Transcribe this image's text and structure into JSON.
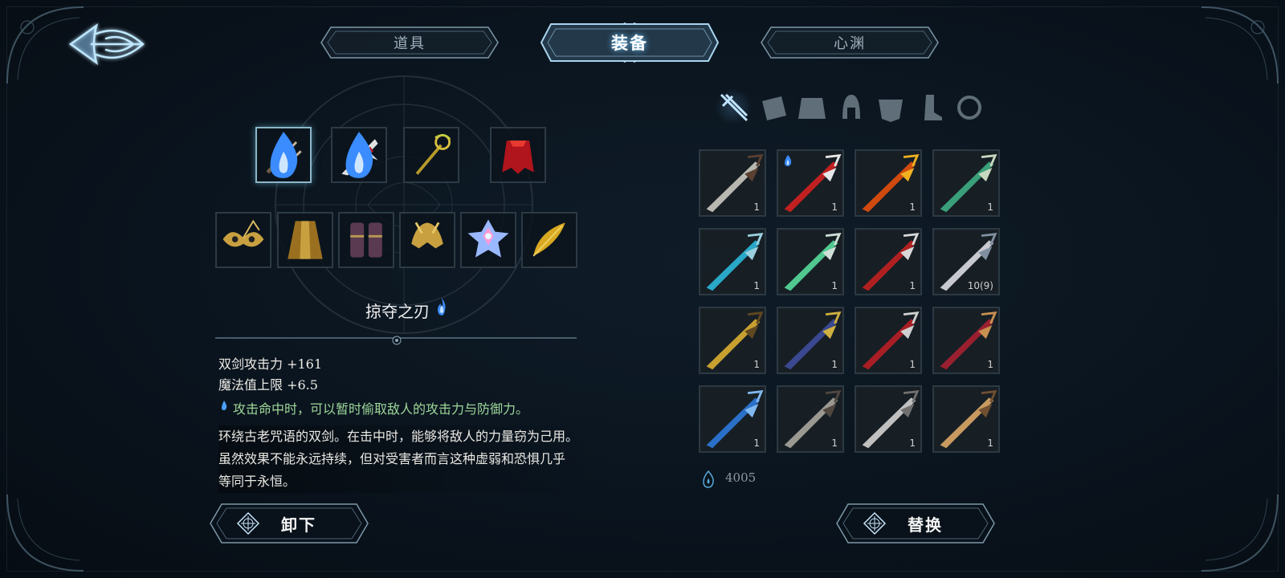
{
  "tabs": [
    {
      "label": "道具",
      "active": false
    },
    {
      "label": "装备",
      "active": true
    },
    {
      "label": "心渊",
      "active": false
    }
  ],
  "equipped_top": [
    {
      "icon": "twin-daggers-icon",
      "flame": true,
      "selected": true
    },
    {
      "icon": "red-blade-icon",
      "flame": true,
      "selected": false
    },
    {
      "icon": "golden-staff-icon",
      "flame": false,
      "selected": false
    },
    {
      "icon": "red-cape-icon",
      "flame": false,
      "selected": false
    }
  ],
  "equipped_bottom": [
    {
      "icon": "butterfly-mask-icon"
    },
    {
      "icon": "golden-robe-icon"
    },
    {
      "icon": "purple-bracers-icon"
    },
    {
      "icon": "golden-helm-icon"
    },
    {
      "icon": "crystal-gem-icon"
    },
    {
      "icon": "golden-feather-icon"
    }
  ],
  "item": {
    "name": "掠夺之刃",
    "stats": [
      "双剑攻击力 +161",
      "魔法值上限 +6.5"
    ],
    "effect": "攻击命中时，可以暂时偷取敌人的攻击力与防御力。",
    "description": [
      "环绕古老咒语的双剑。在击中时，能够将敌人的力量窃为己用。",
      "虽然效果不能永远持续，但对受害者而言这种虚弱和恐惧几乎",
      "等同于永恒。"
    ]
  },
  "buttons": {
    "unequip": "卸下",
    "replace": "替换"
  },
  "categories": [
    {
      "icon": "sword-category-icon",
      "active": true
    },
    {
      "icon": "cape-category-icon",
      "active": false
    },
    {
      "icon": "armor-category-icon",
      "active": false
    },
    {
      "icon": "helmet-category-icon",
      "active": false
    },
    {
      "icon": "chest-category-icon",
      "active": false
    },
    {
      "icon": "boots-category-icon",
      "active": false
    },
    {
      "icon": "ring-category-icon",
      "active": false
    }
  ],
  "inventory": [
    {
      "count": "1",
      "color": "#b8b8b0",
      "accent": "#5a4030",
      "flame": false
    },
    {
      "count": "1",
      "color": "#c02020",
      "accent": "#e8e8e8",
      "flame": true
    },
    {
      "count": "1",
      "color": "#d04a10",
      "accent": "#f0b020",
      "flame": false
    },
    {
      "count": "1",
      "color": "#3aa07a",
      "accent": "#c8d8c0",
      "flame": false
    },
    {
      "count": "1",
      "color": "#2aa8c8",
      "accent": "#9ad0e0",
      "flame": false
    },
    {
      "count": "1",
      "color": "#50c890",
      "accent": "#d0e0d8",
      "flame": false
    },
    {
      "count": "1",
      "color": "#b02020",
      "accent": "#d8d8d8",
      "flame": false
    },
    {
      "count": "10(9)",
      "color": "#c8c8d0",
      "accent": "#8090a0",
      "flame": false
    },
    {
      "count": "1",
      "color": "#c8a030",
      "accent": "#604820",
      "flame": false
    },
    {
      "count": "1",
      "color": "#3a4890",
      "accent": "#d0b040",
      "flame": false
    },
    {
      "count": "1",
      "color": "#a81e24",
      "accent": "#d0d0d0",
      "flame": false
    },
    {
      "count": "1",
      "color": "#9a2030",
      "accent": "#c89050",
      "flame": false
    },
    {
      "count": "1",
      "color": "#2a70c8",
      "accent": "#80b8f0",
      "flame": false
    },
    {
      "count": "1",
      "color": "#9a9890",
      "accent": "#504840",
      "flame": false
    },
    {
      "count": "1",
      "color": "#c0c0c0",
      "accent": "#707070",
      "flame": false
    },
    {
      "count": "1",
      "color": "#c89a60",
      "accent": "#705030",
      "flame": false
    }
  ],
  "currency": {
    "icon": "soul-currency-icon",
    "value": "4005"
  },
  "colors": {
    "accent": "#6fc6ff",
    "effect_text": "#9ed89a",
    "panel_border": "#2c3942"
  }
}
